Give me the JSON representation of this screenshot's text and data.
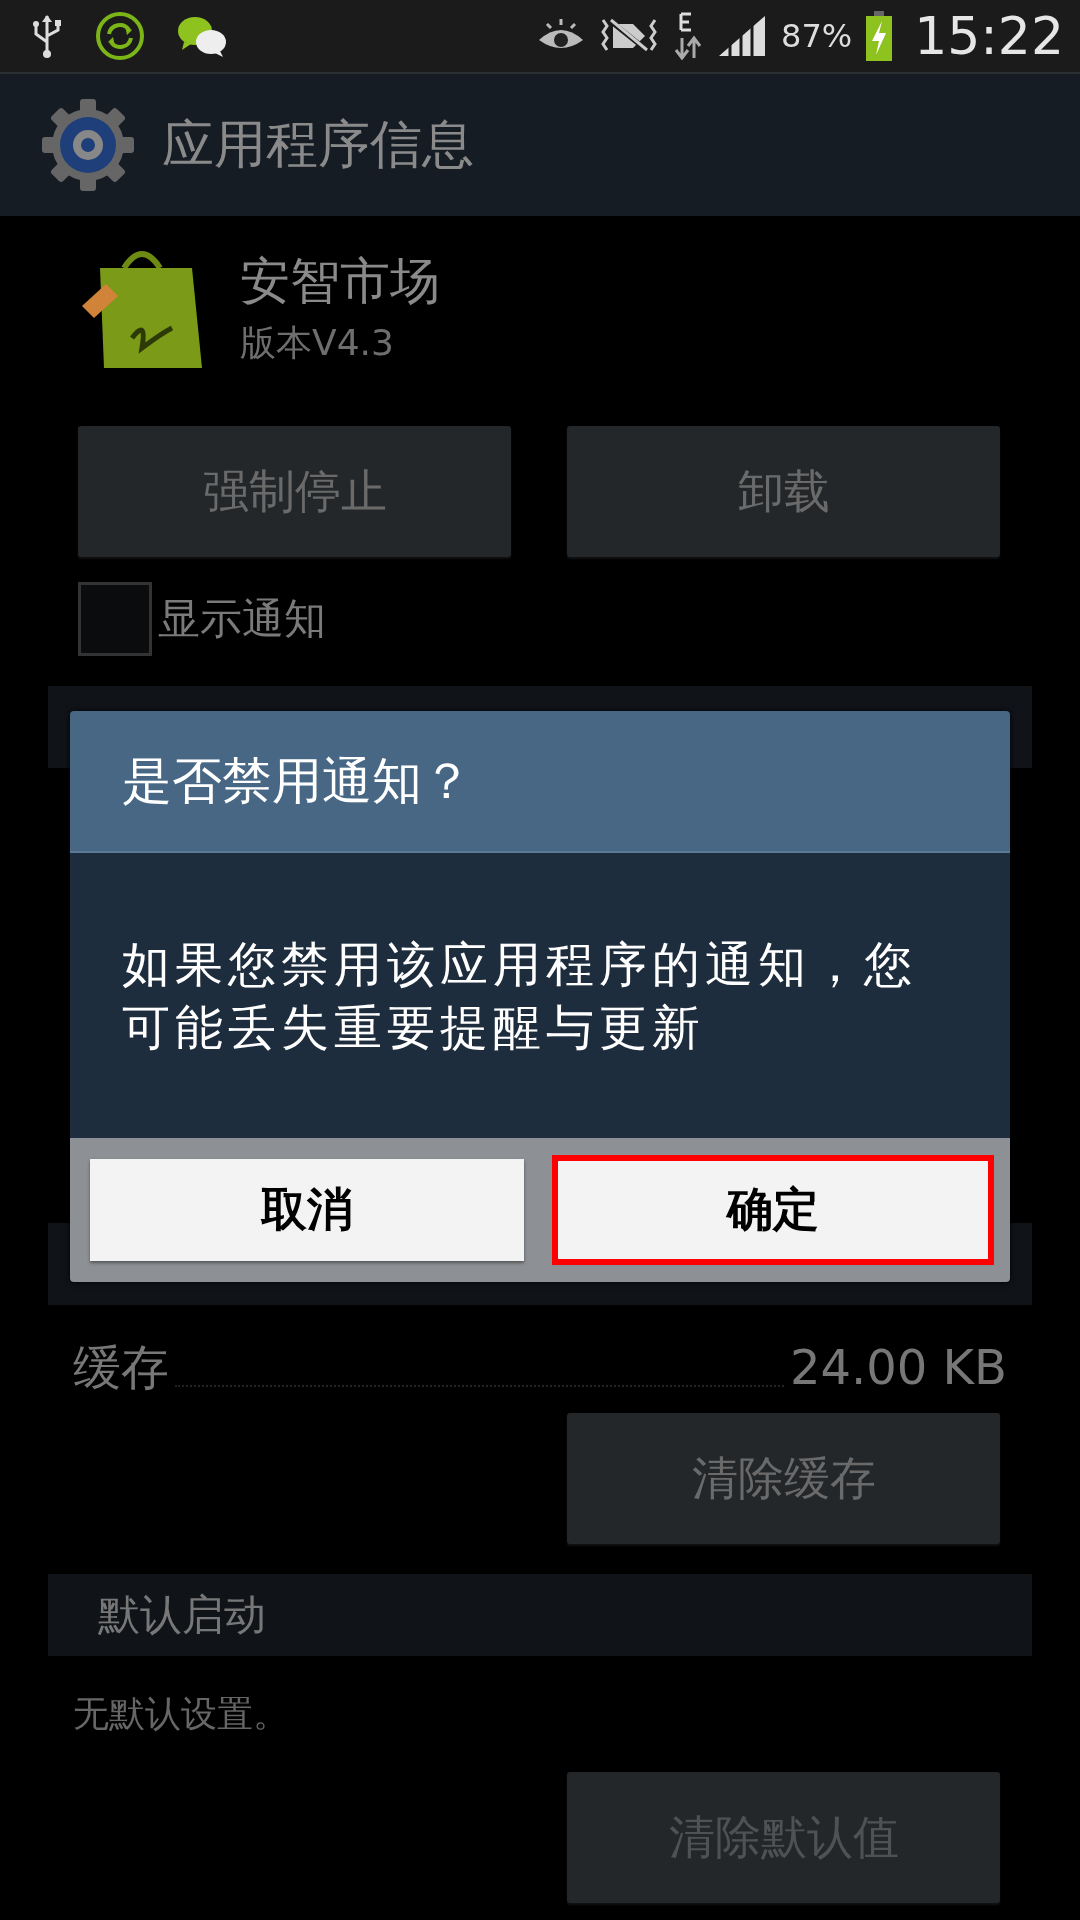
{
  "status_bar": {
    "battery": "87%",
    "time": "15:22"
  },
  "action_bar": {
    "title": "应用程序信息"
  },
  "app": {
    "name": "安智市场",
    "version": "版本V4.3"
  },
  "actions": [
    {
      "label": "强制停止",
      "disabled": false
    },
    {
      "label": "卸载",
      "disabled": false
    }
  ],
  "show_notifications": {
    "label": "显示通知",
    "checked": false
  },
  "storage": {
    "cache_label": "缓存",
    "cache_value": "24.00 KB",
    "clear_button": {
      "label": "清除缓存",
      "disabled": false
    }
  },
  "launch_by_default": {
    "title": "默认启动",
    "description": "无默认设置。",
    "clear_button": {
      "label": "清除默认值",
      "disabled": true
    }
  },
  "dialog": {
    "title": "是否禁用通知？",
    "message": "如果您禁用该应用程序的通知，您可能丢失重要提醒与更新",
    "buttons": [
      {
        "label": "取消",
        "highlighted": false
      },
      {
        "label": "确定",
        "highlighted": true
      }
    ]
  }
}
